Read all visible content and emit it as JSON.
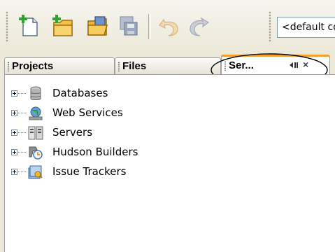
{
  "toolbar": {
    "buttons": [
      {
        "name": "new-file-button",
        "icon": "new-file-icon"
      },
      {
        "name": "new-project-button",
        "icon": "new-project-icon"
      },
      {
        "name": "open-project-button",
        "icon": "open-project-icon"
      },
      {
        "name": "save-all-button",
        "icon": "save-all-icon"
      },
      {
        "name": "undo-button",
        "icon": "undo-icon"
      },
      {
        "name": "redo-button",
        "icon": "redo-icon"
      }
    ],
    "config_select_value": "<default config>"
  },
  "tabs": [
    {
      "label": "Projects"
    },
    {
      "label": "Files"
    },
    {
      "label": "Ser..."
    }
  ],
  "tree": [
    {
      "label": "Databases",
      "icon": "database-icon"
    },
    {
      "label": "Web Services",
      "icon": "web-services-icon"
    },
    {
      "label": "Servers",
      "icon": "servers-icon"
    },
    {
      "label": "Hudson Builders",
      "icon": "hudson-icon"
    },
    {
      "label": "Issue Trackers",
      "icon": "issue-tracker-icon"
    }
  ],
  "colors": {
    "active_tab_accent": "#f0a030",
    "window_background": "#ece9d8"
  }
}
